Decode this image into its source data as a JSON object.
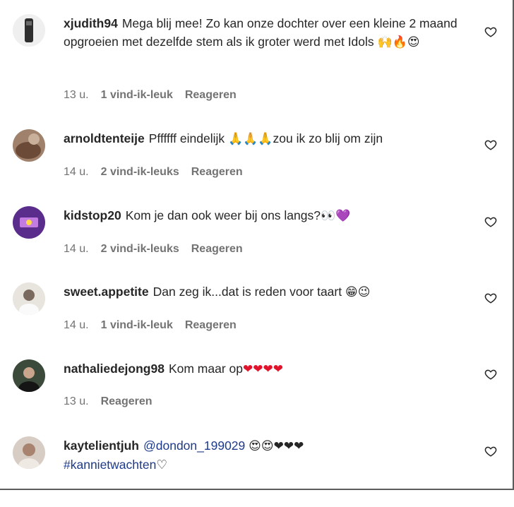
{
  "comments": [
    {
      "username": "xjudith94",
      "text": "Mega blij mee! Zo kan onze dochter over een kleine 2 maand opgroeien met dezelfde stem als ik groter werd met Idols ",
      "emojis": "🙌🔥😍",
      "time": "13 u.",
      "likes": "1 vind-ik-leuk",
      "reply": "Reageren",
      "avatar_color": "#3a3a3a"
    },
    {
      "username": "arnoldtenteije",
      "text": "Pffffff eindelijk ",
      "emojis": "🙏🙏🙏",
      "text_after": "zou ik zo blij om zijn",
      "time": "14 u.",
      "likes": "2 vind-ik-leuks",
      "reply": "Reageren",
      "avatar_color": "#8a6a55"
    },
    {
      "username": "kidstop20",
      "text": "Kom je dan ook weer bij ons langs?",
      "emojis": "👀💜",
      "time": "14 u.",
      "likes": "2 vind-ik-leuks",
      "reply": "Reageren",
      "avatar_color": "#6b3fa0"
    },
    {
      "username": "sweet.appetite",
      "text": "Dan zeg ik...dat is reden voor taart ",
      "emojis": "😁😉",
      "time": "14 u.",
      "likes": "1 vind-ik-leuk",
      "reply": "Reageren",
      "avatar_color": "#d9d4cc"
    },
    {
      "username": "nathaliedejong98",
      "text": "Kom maar op",
      "emojis": "❤❤❤❤",
      "time": "13 u.",
      "likes": "",
      "reply": "Reageren",
      "avatar_color": "#2c2c2c"
    },
    {
      "username": "kaytelientjuh",
      "mention": "@dondon_199029",
      "emojis": "😍😍❤❤❤",
      "hashtag": "#kannietwachten",
      "hashtag_suffix": "♡",
      "time": "",
      "likes": "",
      "reply": "",
      "avatar_color": "#b9a79a"
    }
  ],
  "colors": {
    "text": "#262626",
    "meta": "#737373",
    "link": "#1e3a8a",
    "heart_emoji": "#e0152d"
  },
  "icons": {
    "like": "heart-outline-icon"
  }
}
